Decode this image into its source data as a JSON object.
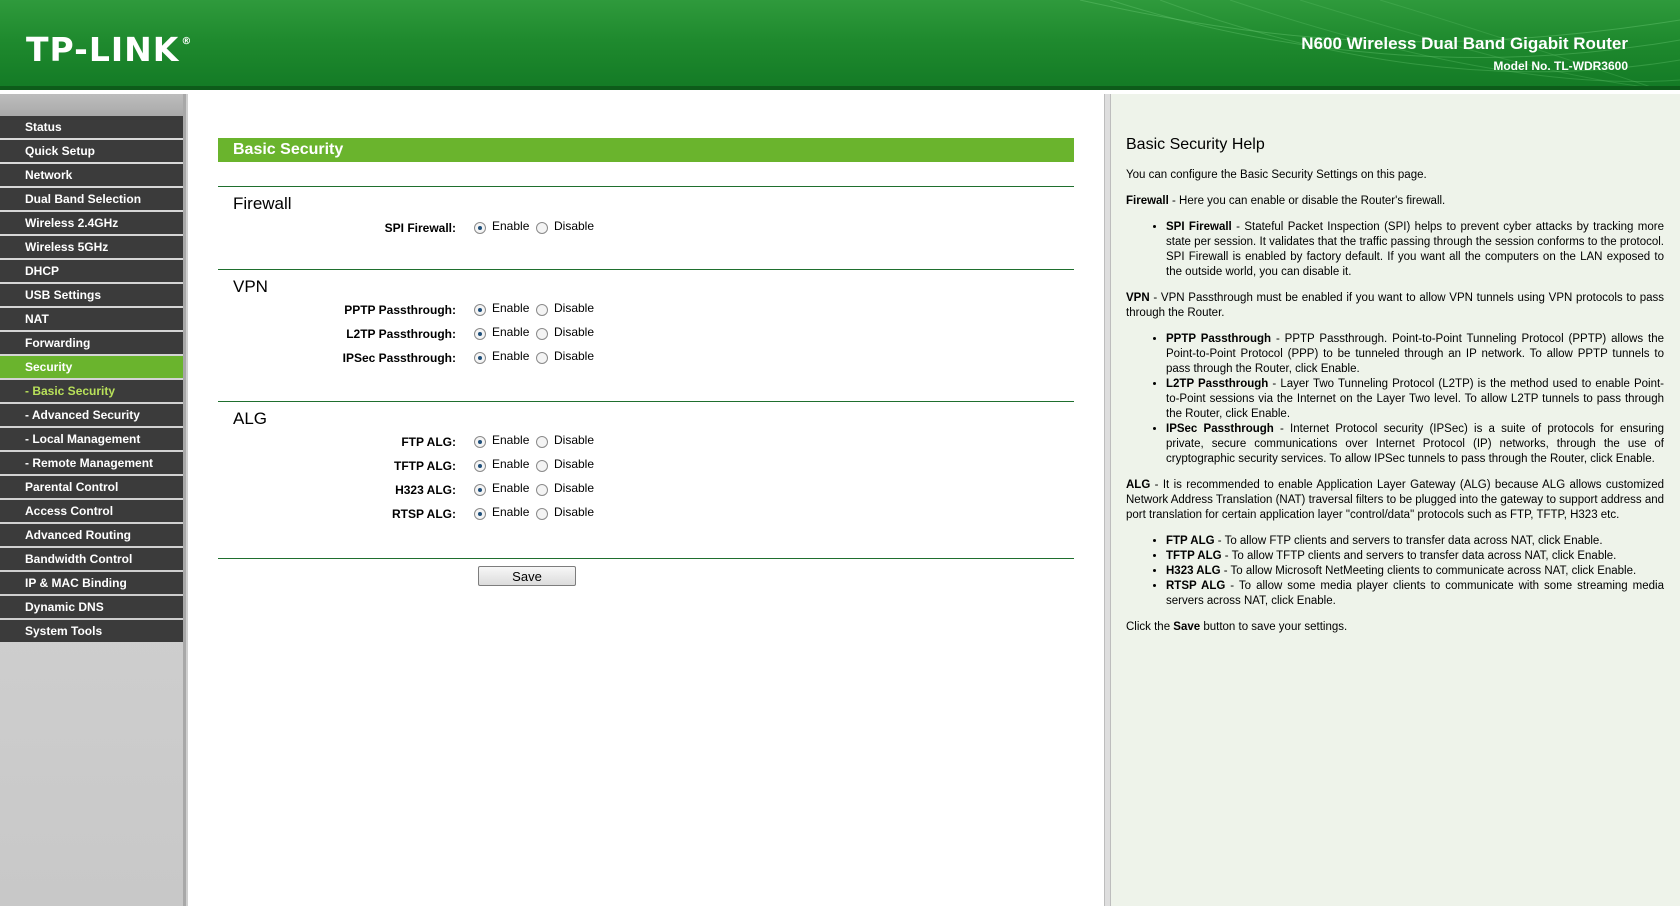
{
  "header": {
    "logo_text": "TP-LINK",
    "logo_mark": "®",
    "product_name": "N600 Wireless Dual Band Gigabit Router",
    "model_no": "Model No. TL-WDR3600"
  },
  "colors": {
    "header_green": "#1f8a2e",
    "accent_green": "#6ab42d",
    "menu_dark": "#3b3b3b",
    "submenu_current": "#b8e05a"
  },
  "sidebar": {
    "items": [
      {
        "label": "Status"
      },
      {
        "label": "Quick Setup"
      },
      {
        "label": "Network"
      },
      {
        "label": "Dual Band Selection"
      },
      {
        "label": "Wireless 2.4GHz"
      },
      {
        "label": "Wireless 5GHz"
      },
      {
        "label": "DHCP"
      },
      {
        "label": "USB Settings"
      },
      {
        "label": "NAT"
      },
      {
        "label": "Forwarding"
      },
      {
        "label": "Security"
      },
      {
        "label": "- Basic Security"
      },
      {
        "label": "- Advanced Security"
      },
      {
        "label": "- Local Management"
      },
      {
        "label": "- Remote Management"
      },
      {
        "label": "Parental Control"
      },
      {
        "label": "Access Control"
      },
      {
        "label": "Advanced Routing"
      },
      {
        "label": "Bandwidth Control"
      },
      {
        "label": "IP & MAC Binding"
      },
      {
        "label": "Dynamic DNS"
      },
      {
        "label": "System Tools"
      }
    ]
  },
  "main": {
    "title": "Basic Security",
    "enable_label": "Enable",
    "disable_label": "Disable",
    "firewall": {
      "title": "Firewall",
      "rows": [
        {
          "label": "SPI Firewall:",
          "value": "Enable"
        }
      ]
    },
    "vpn": {
      "title": "VPN",
      "rows": [
        {
          "label": "PPTP Passthrough:",
          "value": "Enable"
        },
        {
          "label": "L2TP Passthrough:",
          "value": "Enable"
        },
        {
          "label": "IPSec Passthrough:",
          "value": "Enable"
        }
      ]
    },
    "alg": {
      "title": "ALG",
      "rows": [
        {
          "label": "FTP ALG:",
          "value": "Enable"
        },
        {
          "label": "TFTP ALG:",
          "value": "Enable"
        },
        {
          "label": "H323 ALG:",
          "value": "Enable"
        },
        {
          "label": "RTSP ALG:",
          "value": "Enable"
        }
      ]
    },
    "save_label": "Save"
  },
  "help": {
    "title": "Basic Security Help",
    "intro": "You can configure the Basic Security Settings on this page.",
    "firewall_term": "Firewall",
    "firewall_text": " - Here you can enable or disable the Router's firewall.",
    "spi_term": "SPI Firewall",
    "spi_text": " - Stateful Packet Inspection (SPI) helps to prevent cyber attacks by tracking more state per session. It validates that the traffic passing through the session conforms to the protocol. SPI Firewall is enabled by factory default. If you want all the computers on the LAN exposed to the outside world, you can disable it.",
    "vpn_term": "VPN",
    "vpn_text": " - VPN Passthrough must be enabled if you want to allow VPN tunnels using VPN protocols to pass through the Router.",
    "pptp_term": "PPTP Passthrough",
    "pptp_text": " - PPTP Passthrough. Point-to-Point Tunneling Protocol (PPTP) allows the Point-to-Point Protocol (PPP) to be tunneled through an IP network. To allow PPTP tunnels to pass through the Router, click Enable.",
    "l2tp_term": "L2TP Passthrough",
    "l2tp_text": " - Layer Two Tunneling Protocol (L2TP) is the method used to enable Point-to-Point sessions via the Internet on the Layer Two level. To allow L2TP tunnels to pass through the Router, click Enable.",
    "ipsec_term": "IPSec Passthrough",
    "ipsec_text": " - Internet Protocol security (IPSec) is a suite of protocols for ensuring private, secure communications over Internet Protocol (IP) networks, through the use of cryptographic security services. To allow IPSec tunnels to pass through the Router, click Enable.",
    "alg_term": "ALG",
    "alg_text": " - It is recommended to enable Application Layer Gateway (ALG) because ALG allows customized Network Address Translation (NAT) traversal filters to be plugged into the gateway to support address and port translation for certain application layer \"control/data\" protocols such as FTP, TFTP, H323 etc.",
    "ftp_term": "FTP ALG",
    "ftp_text": " - To allow FTP clients and servers to transfer data across NAT, click Enable.",
    "tftp_term": "TFTP ALG",
    "tftp_text": " - To allow TFTP clients and servers to transfer data across NAT, click Enable.",
    "h323_term": "H323 ALG",
    "h323_text": " - To allow Microsoft NetMeeting clients to communicate across NAT, click Enable.",
    "rtsp_term": "RTSP ALG",
    "rtsp_text": " - To allow some media player clients to communicate with some streaming media servers across NAT, click Enable.",
    "outro_pre": "Click the ",
    "outro_term": "Save",
    "outro_post": " button to save your settings."
  }
}
